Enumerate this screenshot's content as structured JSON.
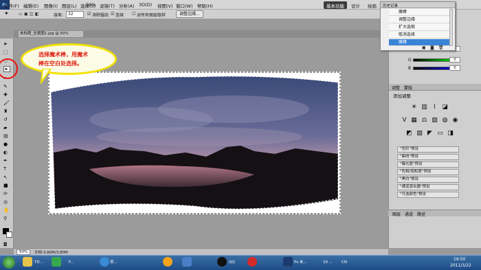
{
  "app": {
    "logo": "Ps",
    "zoom_menu": "50%"
  },
  "menu": [
    "文件(F)",
    "编辑(E)",
    "图像(I)",
    "图层(L)",
    "选择(S)",
    "滤镜(T)",
    "分析(A)",
    "3D(D)",
    "视图(V)",
    "窗口(W)",
    "帮助(H)"
  ],
  "workspaces": {
    "basic": "基本功能",
    "design": "设计",
    "painting": "绘画"
  },
  "options": {
    "tolerance_label": "容差:",
    "tolerance_value": "32",
    "antialias": "消除锯齿",
    "contiguous": "连续",
    "all_layers": "对所有图层取样",
    "refine_edge": "调整边缘..."
  },
  "document": {
    "tab_title": "未标题_全景图1.jpg @ 50%(RGB/8) ×",
    "zoom": "50%",
    "status": "文档:3.80M/3.80M"
  },
  "callout": {
    "line1": "选择魔术棒，用魔术",
    "line2": "棒在空白处选择。"
  },
  "history": {
    "title": "历史记录",
    "items": [
      "魔棒",
      "调整边缘",
      "扩大选取",
      "取消选择",
      "魔棒"
    ],
    "selected_index": 4
  },
  "color_panel": {
    "r": "0",
    "g": "0",
    "b": "0",
    "r_label": "R",
    "g_label": "G",
    "b_label": "B"
  },
  "adjustments": {
    "tab1": "调整",
    "tab2": "蒙版",
    "title": "添加调整",
    "presets": [
      "\"色阶\"预设",
      "\"曲线\"预设",
      "\"曝光度\"预设",
      "\"色相/饱和度\"预设",
      "\"黑白\"预设",
      "\"通道混合器\"预设",
      "\"可选颜色\"预设"
    ]
  },
  "layers_tabs": [
    "图层",
    "通道",
    "路径"
  ],
  "taskbar": {
    "items": [
      "TD...",
      "F...",
      "吴...",
      "QQ",
      "Ps 未...",
      "10 ..."
    ],
    "time": "16:50",
    "date": "2011/3/22",
    "tray_cn": "CN"
  }
}
